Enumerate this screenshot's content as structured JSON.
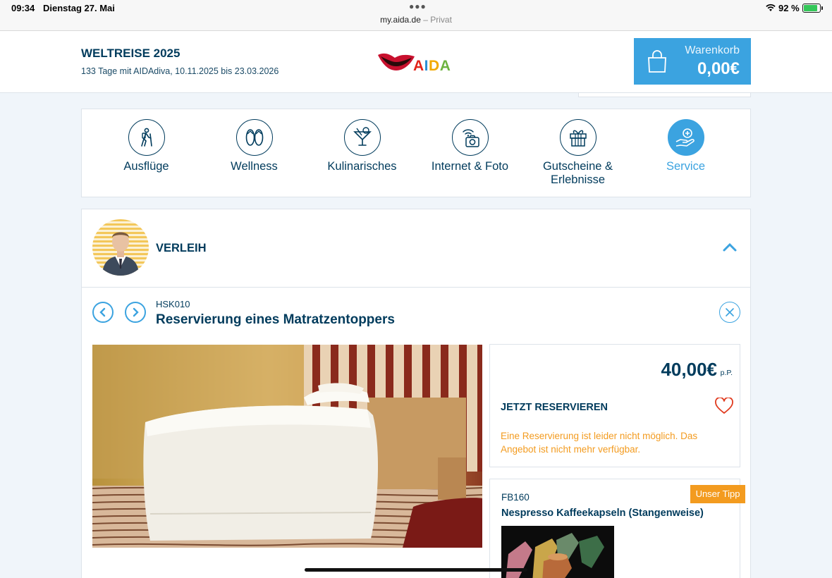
{
  "status_bar": {
    "time": "09:34",
    "date": "Dienstag 27. Mai",
    "url": "my.aida.de",
    "url_suffix": "– Privat",
    "battery": "92 %",
    "battery_level": 0.92
  },
  "header": {
    "trip_title": "WELTREISE 2025",
    "trip_subtitle": "133 Tage mit AIDAdiva, 10.11.2025 bis 23.03.2026",
    "logo_text": "AIDA",
    "cart_label": "Warenkorb",
    "cart_amount": "0,00€"
  },
  "categories": [
    {
      "label": "Ausflüge",
      "icon": "hiker-icon",
      "active": false
    },
    {
      "label": "Wellness",
      "icon": "flip-flops-icon",
      "active": false
    },
    {
      "label": "Kulinarisches",
      "icon": "cocktail-icon",
      "active": false
    },
    {
      "label": "Internet & Foto",
      "icon": "wifi-camera-icon",
      "active": false
    },
    {
      "label": "Gutscheine & Erlebnisse",
      "icon": "gift-icon",
      "active": false
    },
    {
      "label": "Service",
      "icon": "service-hand-icon",
      "active": true
    }
  ],
  "section": {
    "title": "VERLEIH"
  },
  "product": {
    "code": "HSK010",
    "title": "Reservierung eines Matratzentoppers",
    "price": "40,00€",
    "price_unit": "p.P.",
    "reserve_label": "JETZT RESERVIEREN",
    "notice": "Eine Reservierung ist leider nicht möglich. Das Angebot ist nicht mehr verfügbar."
  },
  "tip": {
    "badge": "Unser Tipp",
    "code": "FB160",
    "title": "Nespresso Kaffeekapseln (Stangenweise)"
  },
  "colors": {
    "primary": "#003b5c",
    "accent": "#3ba3e0",
    "warning": "#f39b1f"
  }
}
